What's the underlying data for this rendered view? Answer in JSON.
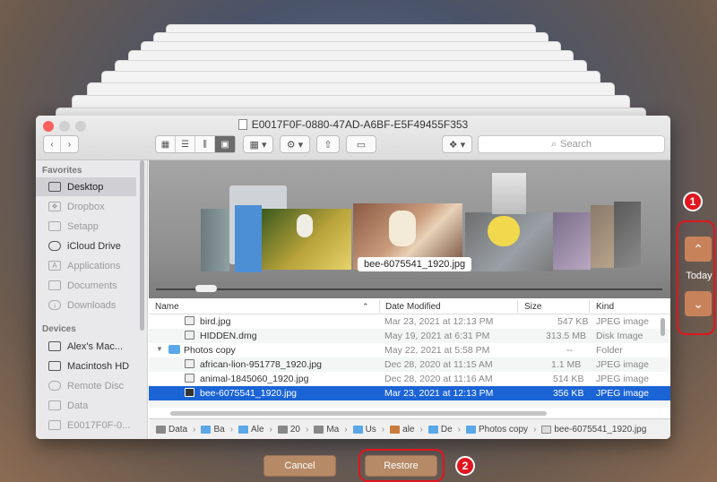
{
  "window": {
    "title": "E0017F0F-0880-47AD-A6BF-E5F49455F353"
  },
  "toolbar": {
    "search_placeholder": "Search"
  },
  "sidebar": {
    "favorites_heading": "Favorites",
    "favorites": [
      "Desktop",
      "Dropbox",
      "Setapp",
      "iCloud Drive",
      "Applications",
      "Documents",
      "Downloads"
    ],
    "devices_heading": "Devices",
    "devices": [
      "Alex's Mac...",
      "Macintosh HD",
      "Remote Disc",
      "Data",
      "E0017F0F-0..."
    ]
  },
  "coverflow": {
    "selected_label": "bee-6075541_1920.jpg"
  },
  "columns": {
    "name": "Name",
    "date": "Date Modified",
    "size": "Size",
    "kind": "Kind"
  },
  "files": [
    {
      "name": "bird.jpg",
      "date": "Mar 23, 2021 at 12:13 PM",
      "size": "547 KB",
      "kind": "JPEG image"
    },
    {
      "name": "HIDDEN.dmg",
      "date": "May 19, 2021 at 6:31 PM",
      "size": "313.5 MB",
      "kind": "Disk Image"
    },
    {
      "name": "Photos copy",
      "date": "May 22, 2021 at 5:58 PM",
      "size": "--",
      "kind": "Folder"
    },
    {
      "name": "african-lion-951778_1920.jpg",
      "date": "Dec 28, 2020 at 11:15 AM",
      "size": "1.1 MB",
      "kind": "JPEG image"
    },
    {
      "name": "animal-1845060_1920.jpg",
      "date": "Dec 28, 2020 at 11:16 AM",
      "size": "514 KB",
      "kind": "JPEG image"
    },
    {
      "name": "bee-6075541_1920.jpg",
      "date": "Mar 23, 2021 at 12:13 PM",
      "size": "356 KB",
      "kind": "JPEG image"
    }
  ],
  "pathbar": [
    "Data",
    "Ba",
    "Ale",
    "20",
    "Ma",
    "Us",
    "ale",
    "De",
    "Photos copy",
    "bee-6075541_1920.jpg"
  ],
  "buttons": {
    "cancel": "Cancel",
    "restore": "Restore"
  },
  "timemachine": {
    "today_label": "Today",
    "up_icon": "chevron-up-icon",
    "down_icon": "chevron-down-icon"
  },
  "annotations": {
    "step1": "1",
    "step2": "2"
  },
  "colors": {
    "accent_red": "#e0161e",
    "button_brown": "#b68a66",
    "selection_blue": "#1b64d6"
  }
}
